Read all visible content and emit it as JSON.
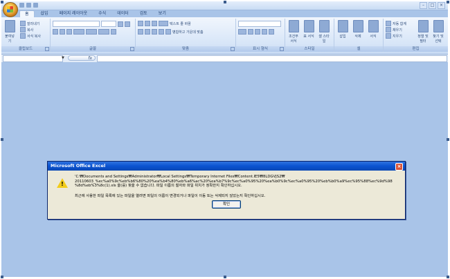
{
  "window": {
    "title": "",
    "controls": [
      "–",
      "□",
      "×"
    ]
  },
  "tabs": [
    "홈",
    "삽입",
    "페이지 레이아웃",
    "수식",
    "데이터",
    "검토",
    "보기"
  ],
  "ribbon": {
    "clipboard": {
      "label": "클립보드",
      "paste": "붙여넣기",
      "cut": "잘라내기",
      "copy": "복사",
      "format_painter": "서식 복사"
    },
    "font": {
      "label": "글꼴"
    },
    "alignment": {
      "label": "맞춤",
      "wrap_text": "텍스트 줄 바꿈",
      "merge_center": "병합하고 가운데 맞춤"
    },
    "number": {
      "label": "표시 형식"
    },
    "styles": {
      "label": "스타일",
      "conditional": "조건부 서식",
      "table": "표 서식",
      "cell": "셀 스타일"
    },
    "cells": {
      "label": "셀",
      "insert": "삽입",
      "delete": "삭제",
      "format": "서식"
    },
    "editing": {
      "label": "편집",
      "autosum": "자동 합계",
      "fill": "채우기",
      "clear": "지우기",
      "sort": "정렬 및 필터",
      "find": "찾기 및 선택"
    }
  },
  "formula_bar": {
    "name_box": "",
    "fx_label": "fx",
    "formula": ""
  },
  "dialog": {
    "title": "Microsoft Office Excel",
    "message_line1": "'C:₩Documents and Settings₩Administrator₩Local Settings₩Temporary Internet Files₩Content.IE5₩8LDGVJS2₩",
    "message_line2": "20110603_%ec%a0%9c%eb%b6%80%20%ea%b4%80%eb%a6%ac%20%ea%b7%9c%ec%a0%95%20%ea%b0%9c%ec%a0%95%20%eb%b0%a9%ec%95%88%ec%9d%98",
    "message_line3": "%8d%eb%3%8c(1).xls 을(를) 찾을 수 없습니다. 파일 이름의 철자와 파일 위치가 정확한지 확인하십시오.",
    "message_line4": "최근에 사용한 파일 목록에 있는 파일을 열려면 파일의 이름이 변경되거나 파일이 이동 또는 삭제되지 않았는지 확인하십시오.",
    "ok_label": "확인"
  }
}
